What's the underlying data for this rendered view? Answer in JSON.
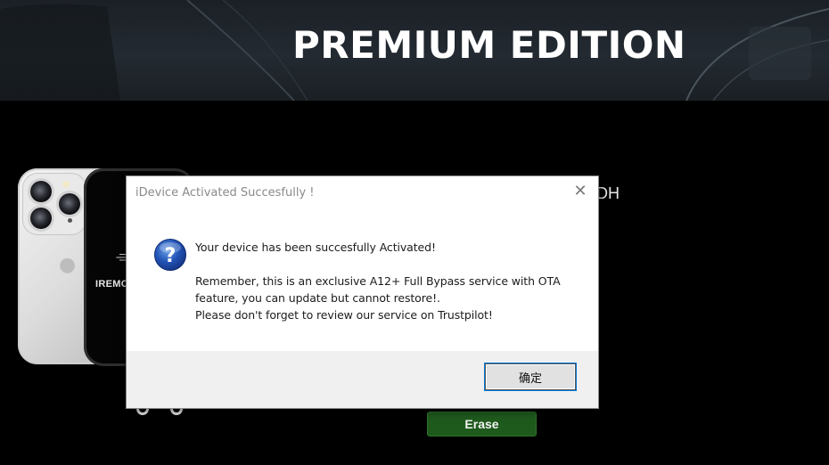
{
  "banner": {
    "title": "PREMIUM EDITION"
  },
  "background_app": {
    "phone_label": "IREMO",
    "partial_label": "DH",
    "erase_button": "Erase"
  },
  "dialog": {
    "title": "iDevice Activated Succesfully !",
    "icon": "question-icon",
    "message_lines": [
      "Your device has been succesfully Activated!",
      "Remember, this is an exclusive A12+ Full Bypass service with OTA",
      "feature, you can update but cannot restore!.",
      "Please don't forget to review our service on Trustpilot!"
    ],
    "ok_button": "确定"
  },
  "colors": {
    "background": "#000000",
    "banner": "#1f252b",
    "erase_button": "#1f5a1d",
    "dialog_footer": "#f0f0f0",
    "question_icon": "#1f4fa8"
  }
}
